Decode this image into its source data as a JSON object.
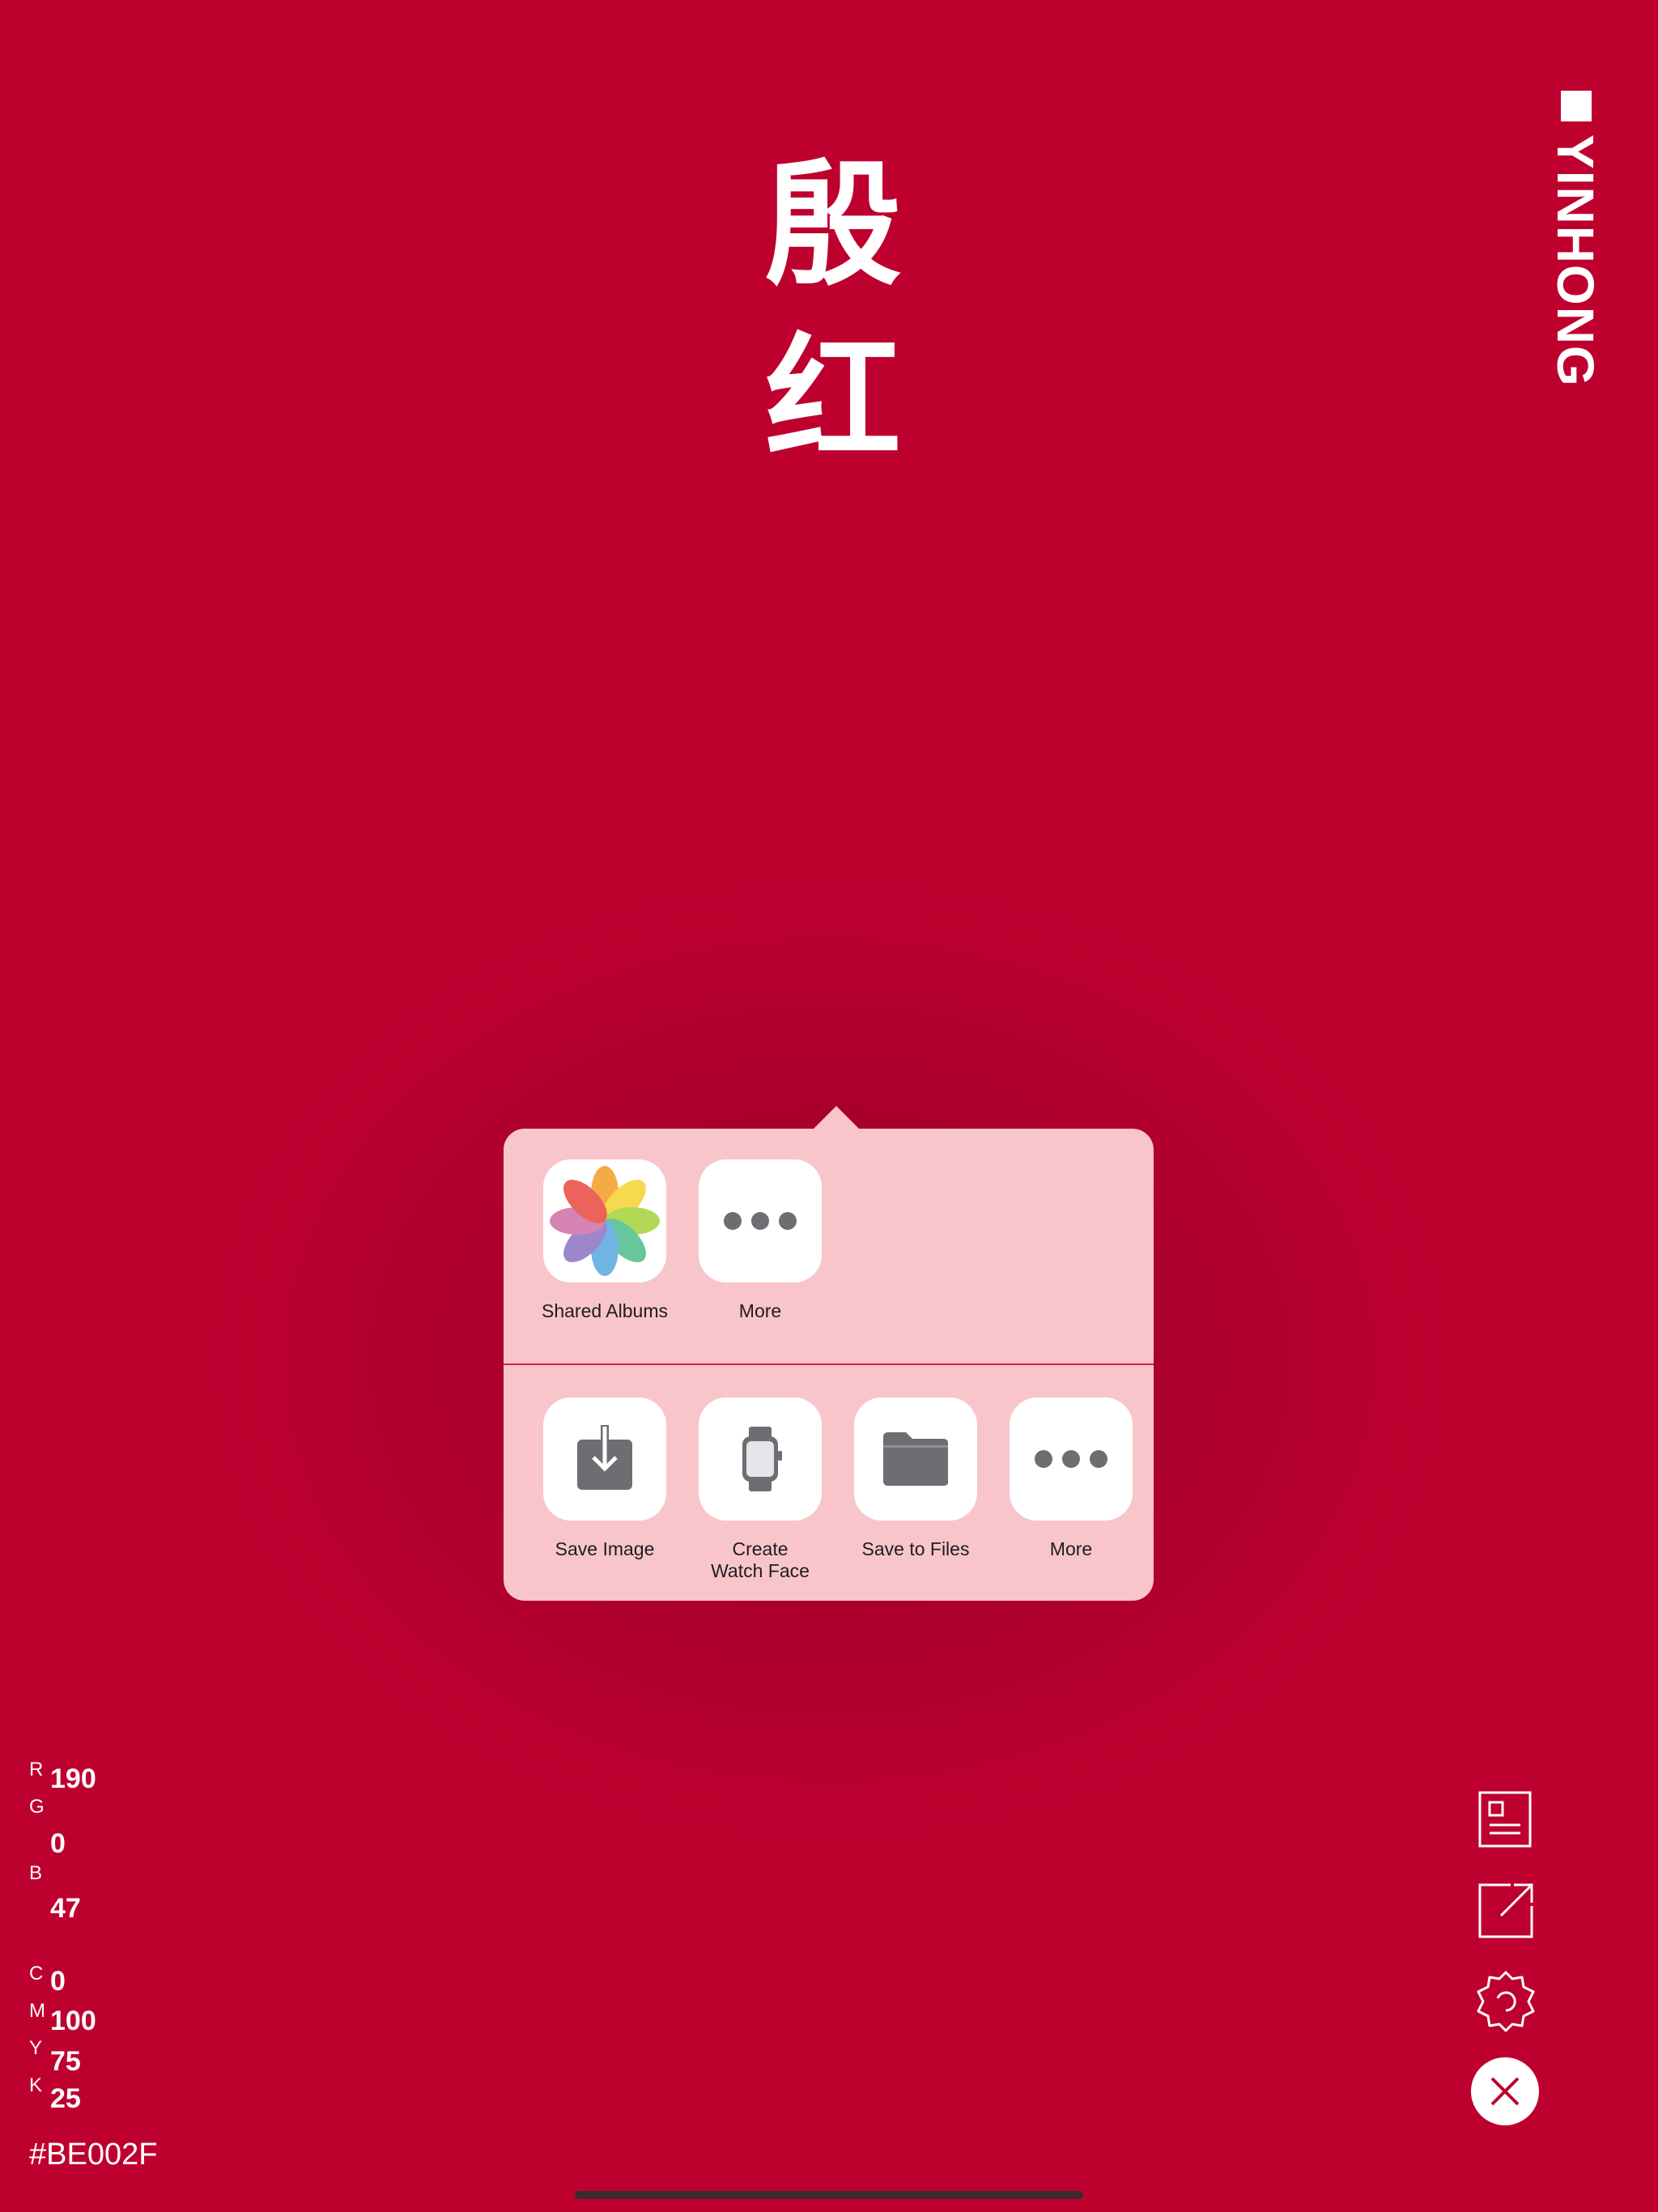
{
  "colors": {
    "background": "#BE002F",
    "popover": "#F8C5CB",
    "divider": "#D8213E"
  },
  "title": {
    "char1": "殷",
    "char2": "红",
    "pinyin": "YINHONG"
  },
  "share_sheet": {
    "row1": [
      {
        "label": "Shared Albums",
        "icon": "photos-icon"
      },
      {
        "label": "More",
        "icon": "more-dots-icon"
      }
    ],
    "row2": [
      {
        "label": "Save Image",
        "icon": "save-image-icon"
      },
      {
        "label": "Create\nWatch Face",
        "icon": "watch-icon"
      },
      {
        "label": "Save to Files",
        "icon": "folder-icon"
      },
      {
        "label": "More",
        "icon": "more-dots-icon"
      }
    ]
  },
  "rgb": {
    "r_label": "R",
    "g_label": "G",
    "b_label": "B",
    "r": "190",
    "g": "0",
    "b": "47"
  },
  "cmyk": {
    "c_label": "C",
    "m_label": "M",
    "y_label": "Y",
    "k_label": "K",
    "c": "0",
    "m": "100",
    "y": "75",
    "k": "25"
  },
  "hex": "#BE002F",
  "toolbar": {
    "icons": [
      "card-icon",
      "share-icon",
      "settings-icon",
      "close-icon"
    ]
  }
}
